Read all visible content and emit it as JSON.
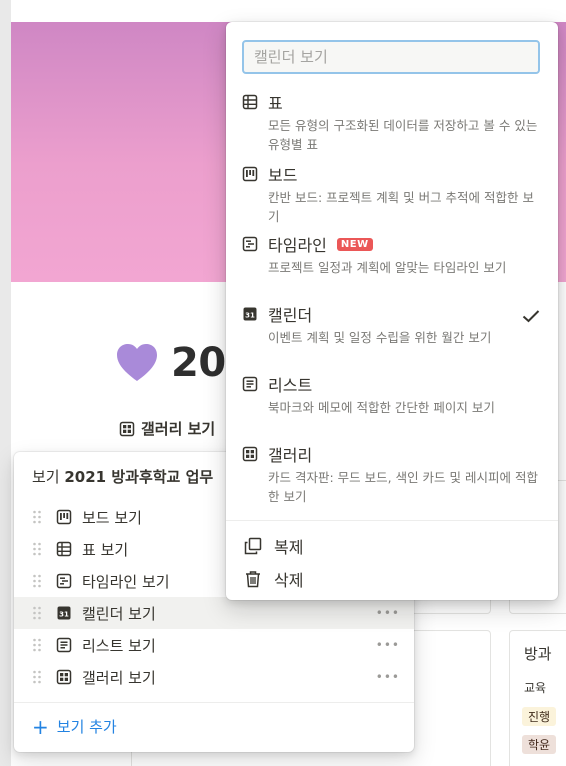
{
  "page": {
    "title": "20",
    "view_tab_label": "갤러리 보기"
  },
  "cards": {
    "right_top_title": "방과",
    "right_top_sub": "교육",
    "right_tag_1": "진행",
    "right_tag_2": "학윤"
  },
  "views_panel": {
    "header_prefix": "보기 ",
    "header_db": "2021 방과후학교 업무",
    "items": [
      {
        "label": "보드 보기",
        "icon": "board-icon"
      },
      {
        "label": "표 보기",
        "icon": "table-icon"
      },
      {
        "label": "타임라인 보기",
        "icon": "timeline-icon"
      },
      {
        "label": "캘린더 보기",
        "icon": "calendar-icon"
      },
      {
        "label": "리스트 보기",
        "icon": "list-icon"
      },
      {
        "label": "갤러리 보기",
        "icon": "gallery-icon"
      }
    ],
    "more_label": "•••",
    "add_label": "보기 추가"
  },
  "menu": {
    "search_placeholder": "캘린더 보기",
    "options": [
      {
        "title": "표",
        "desc": "모든 유형의 구조화된 데이터를 저장하고 볼 수 있는 유형별 표",
        "icon": "table-icon"
      },
      {
        "title": "보드",
        "desc": "칸반 보드: 프로젝트 계획 및 버그 추적에 적합한 보기",
        "icon": "board-icon"
      },
      {
        "title": "타임라인",
        "badge": "NEW",
        "desc": "프로젝트 일정과 계획에 알맞는 타임라인 보기",
        "icon": "timeline-icon"
      },
      {
        "title": "캘린더",
        "desc": "이벤트 계획 및 일정 수립을 위한 월간 보기",
        "icon": "calendar-icon",
        "selected": true
      },
      {
        "title": "리스트",
        "desc": "북마크와 메모에 적합한 간단한 페이지 보기",
        "icon": "list-icon"
      },
      {
        "title": "갤러리",
        "desc": "카드 격자판: 무드 보드, 색인 카드 및 레시피에 적합한 보기",
        "icon": "gallery-icon"
      }
    ],
    "actions": {
      "duplicate": "복제",
      "delete": "삭제"
    }
  },
  "colors": {
    "accent": "#2383e2",
    "badge": "#eb5757",
    "heart": "#9b7fd4"
  }
}
